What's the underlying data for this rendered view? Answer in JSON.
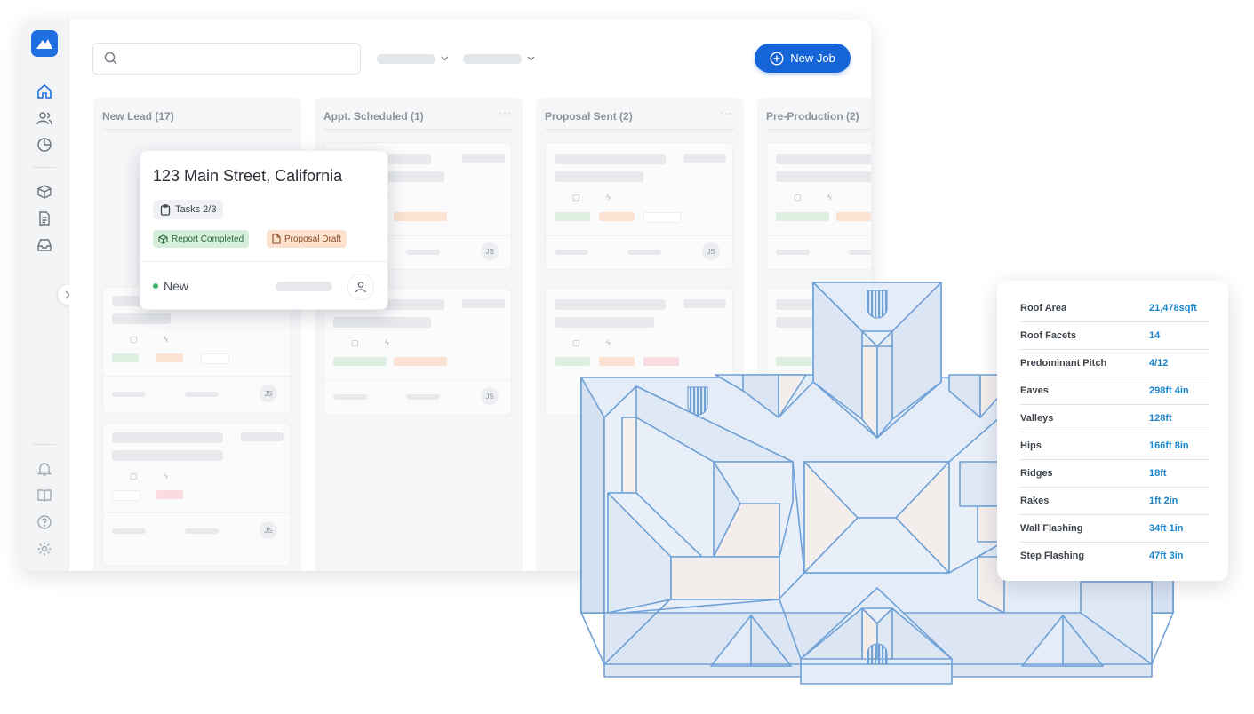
{
  "search": {
    "placeholder": "",
    "value": ""
  },
  "toolbar": {
    "new_job_label": "New Job"
  },
  "columns": [
    {
      "title": "New Lead (17)"
    },
    {
      "title": "Appt. Scheduled (1)",
      "more": "···"
    },
    {
      "title": "Proposal Sent (2)",
      "more": "···"
    },
    {
      "title": "Pre-Production (2)"
    }
  ],
  "card_initials": "JS",
  "popup": {
    "title": "123 Main Street, California",
    "tasks": "Tasks 2/3",
    "report_badge": "Report Completed",
    "proposal_badge": "Proposal Draft",
    "status": "New"
  },
  "metrics": [
    {
      "label": "Roof Area",
      "value": "21,478sqft"
    },
    {
      "label": "Roof Facets",
      "value": "14"
    },
    {
      "label": "Predominant Pitch",
      "value": "4/12"
    },
    {
      "label": "Eaves",
      "value": "298ft 4in"
    },
    {
      "label": "Valleys",
      "value": "128ft"
    },
    {
      "label": "Hips",
      "value": "166ft 8in"
    },
    {
      "label": "Ridges",
      "value": "18ft"
    },
    {
      "label": "Rakes",
      "value": "1ft 2in"
    },
    {
      "label": "Wall Flashing",
      "value": "34ft 1in"
    },
    {
      "label": "Step Flashing",
      "value": "47ft 3in"
    }
  ],
  "colors": {
    "accent": "#1665d8",
    "metric_value": "#1a86c9",
    "roof_stroke": "#6fa1d6",
    "roof_fill": "#e4ecf7",
    "status_new": "#3cb46e"
  },
  "icons": {
    "sidebar": [
      "home-icon",
      "users-icon",
      "pie-chart-icon",
      "box-icon",
      "document-icon",
      "inbox-icon",
      "bell-icon",
      "book-icon",
      "help-icon",
      "settings-icon"
    ]
  }
}
